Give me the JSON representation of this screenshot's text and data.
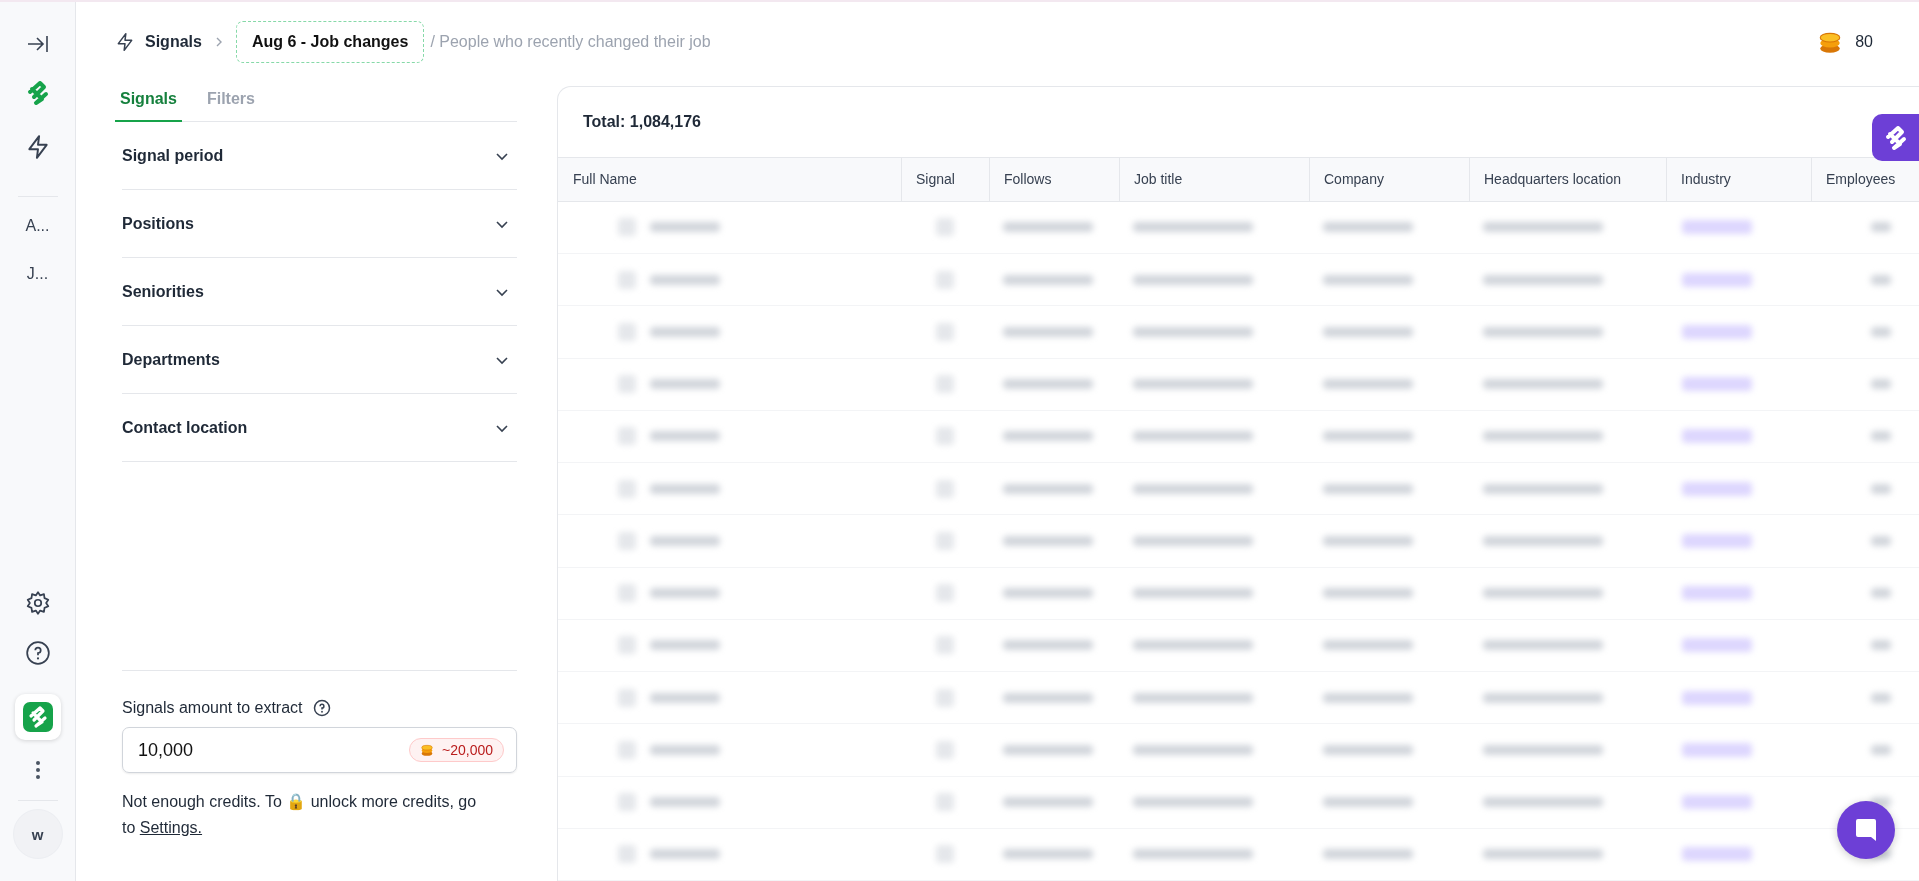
{
  "sidebar": {
    "items": [
      {
        "label": "A..."
      },
      {
        "label": "J..."
      }
    ],
    "avatar": "w"
  },
  "breadcrumb": {
    "root": "Signals",
    "current": "Aug 6 - Job changes",
    "description": "/ People who recently changed their job"
  },
  "credits": "80",
  "tabs": [
    {
      "label": "Signals",
      "selected": true
    },
    {
      "label": "Filters",
      "selected": false
    }
  ],
  "filters": [
    {
      "label": "Signal period",
      "expanded": false
    },
    {
      "label": "Positions",
      "expanded": false
    },
    {
      "label": "Seniorities",
      "expanded": false
    },
    {
      "label": "Departments",
      "expanded": false
    },
    {
      "label": "Contact location",
      "expanded": false
    }
  ],
  "amount": {
    "label": "Signals amount to extract",
    "value": "10,000",
    "cost": "~20,000"
  },
  "notice": {
    "text": "Not enough credits. To 🔒 unlock more credits, go to",
    "link": "Settings."
  },
  "table": {
    "total": "Total: 1,084,176",
    "columns": [
      "Full Name",
      "Signal",
      "Follows",
      "Job title",
      "Company",
      "Headquarters location",
      "Industry",
      "Employees"
    ],
    "rows": [
      {
        "blurred": true
      },
      {
        "blurred": true
      },
      {
        "blurred": true
      },
      {
        "blurred": true
      },
      {
        "blurred": true
      },
      {
        "blurred": true
      },
      {
        "blurred": true
      },
      {
        "blurred": true
      },
      {
        "blurred": true
      },
      {
        "blurred": true
      },
      {
        "blurred": true
      },
      {
        "blurred": true
      },
      {
        "blurred": true
      }
    ]
  }
}
